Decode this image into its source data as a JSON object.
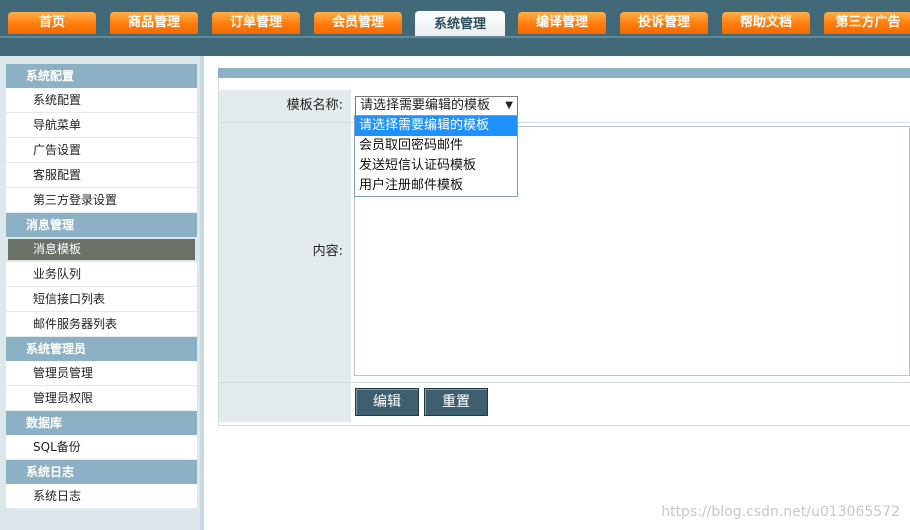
{
  "topnav": {
    "tabs": [
      {
        "label": "首页"
      },
      {
        "label": "商品管理"
      },
      {
        "label": "订单管理"
      },
      {
        "label": "会员管理"
      },
      {
        "label": "系统管理",
        "active": true
      },
      {
        "label": "编译管理"
      },
      {
        "label": "投诉管理"
      },
      {
        "label": "帮助文档"
      },
      {
        "label": "第三方广告"
      }
    ]
  },
  "sidebar": {
    "groups": [
      {
        "title": "系统配置",
        "items": [
          "系统配置",
          "导航菜单",
          "广告设置",
          "客服配置",
          "第三方登录设置"
        ]
      },
      {
        "title": "消息管理",
        "items": [
          "消息模板",
          "业务队列",
          "短信接口列表",
          "邮件服务器列表"
        ]
      },
      {
        "title": "系统管理员",
        "items": [
          "管理员管理",
          "管理员权限"
        ]
      },
      {
        "title": "数据库",
        "items": [
          "SQL备份"
        ]
      },
      {
        "title": "系统日志",
        "items": [
          "系统日志"
        ]
      }
    ],
    "active_item": "消息模板"
  },
  "form": {
    "template_label": "模板名称:",
    "content_label": "内容:",
    "select_value": "请选择需要编辑的模板",
    "options": [
      "请选择需要编辑的模板",
      "会员取回密码邮件",
      "发送短信认证码模板",
      "用户注册邮件模板"
    ],
    "edit_button": "编辑",
    "reset_button": "重置"
  },
  "watermark": "https://blog.csdn.net/u013065572",
  "colors": {
    "nav_bg": "#426978",
    "tab_orange": "#ff7b0a",
    "group_bg": "#8db1c4",
    "button_bg": "#3e5f6e",
    "option_highlight": "#1e90ff"
  }
}
